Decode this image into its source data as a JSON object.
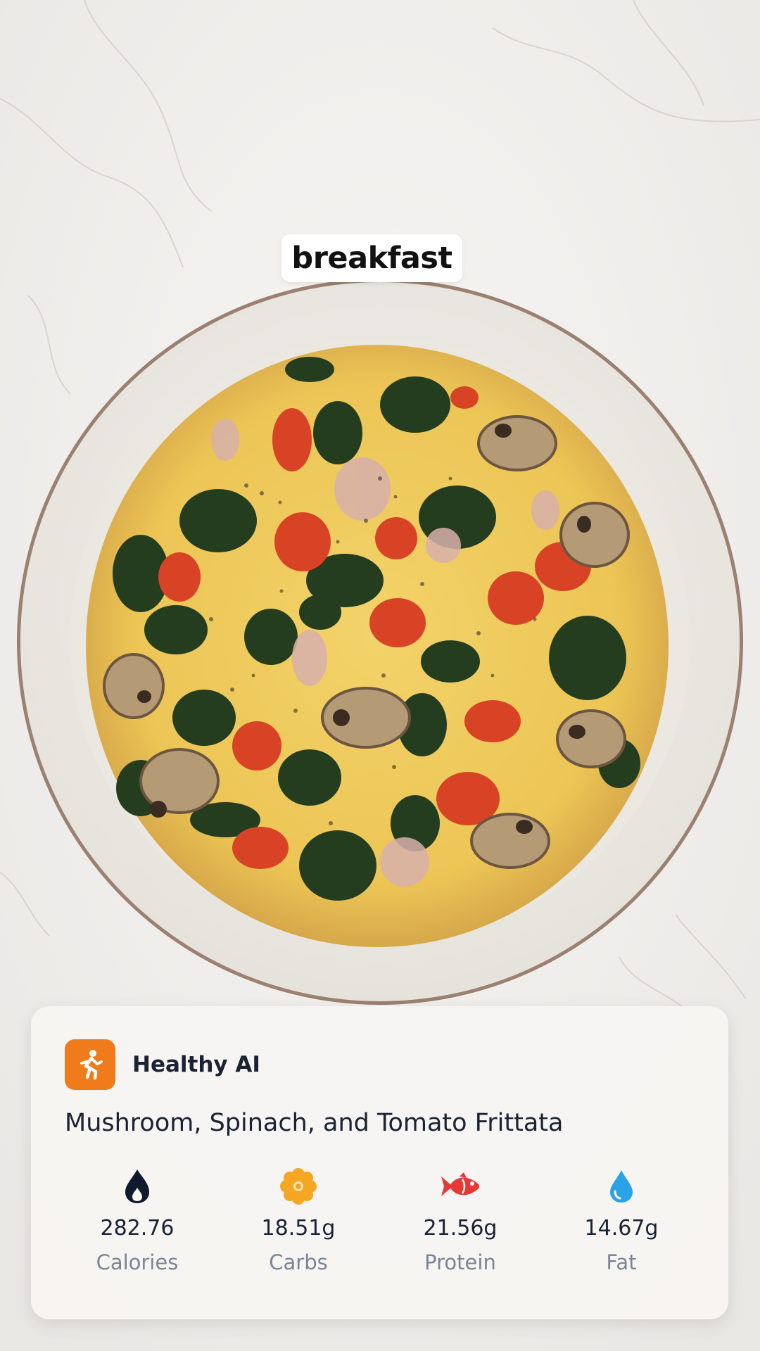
{
  "meal_tag": "breakfast",
  "card": {
    "brand": {
      "name": "Healthy AI",
      "icon": "running-person-icon",
      "color": "#f07b1a"
    },
    "dish_title": "Mushroom, Spinach, and Tomato Frittata",
    "nutrients": [
      {
        "value": "282.76",
        "label": "Calories",
        "icon": "flame-icon",
        "color": "#101a2e"
      },
      {
        "value": "18.51g",
        "label": "Carbs",
        "icon": "flower-icon",
        "color": "#f5a623"
      },
      {
        "value": "21.56g",
        "label": "Protein",
        "icon": "fish-icon",
        "color": "#e53935"
      },
      {
        "value": "14.67g",
        "label": "Fat",
        "icon": "droplet-icon",
        "color": "#29a3e6"
      }
    ]
  }
}
